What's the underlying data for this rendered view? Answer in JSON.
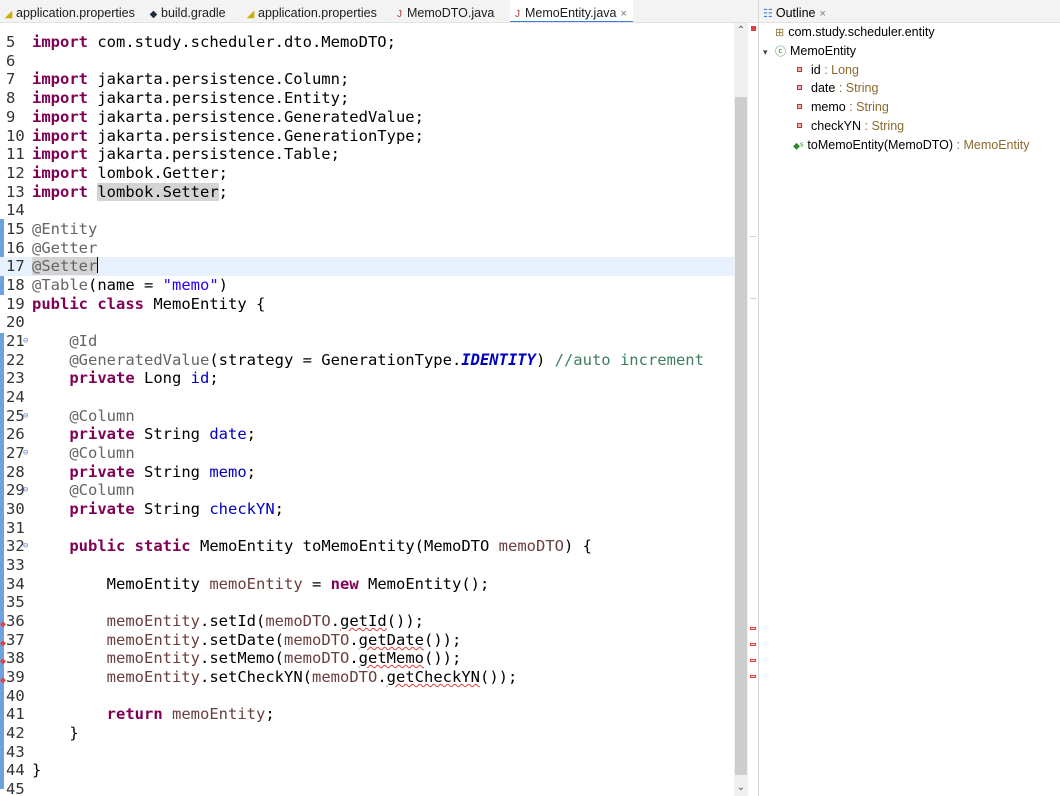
{
  "tabs": [
    {
      "label": "application.properties",
      "icon": "properties-file-icon",
      "active": false
    },
    {
      "label": "build.gradle",
      "icon": "gradle-file-icon",
      "active": false
    },
    {
      "label": "application.properties",
      "icon": "properties-file-icon",
      "active": false
    },
    {
      "label": "MemoDTO.java",
      "icon": "java-file-icon",
      "active": false
    },
    {
      "label": "MemoEntity.java",
      "icon": "java-file-icon",
      "active": true,
      "close": "×"
    }
  ],
  "editor": {
    "lines": {
      "l5": {
        "num": "5",
        "import_path": "com.study.scheduler.dto.MemoDTO"
      },
      "l6": {
        "num": "6"
      },
      "l7": {
        "num": "7",
        "import_path": "jakarta.persistence.Column"
      },
      "l8": {
        "num": "8",
        "import_path": "jakarta.persistence.Entity"
      },
      "l9": {
        "num": "9",
        "import_path": "jakarta.persistence.GeneratedValue"
      },
      "l10": {
        "num": "10",
        "import_path": "jakarta.persistence.GenerationType"
      },
      "l11": {
        "num": "11",
        "import_path": "jakarta.persistence.Table"
      },
      "l12": {
        "num": "12",
        "import_path": "lombok.Getter"
      },
      "l13": {
        "num": "13",
        "import_path": "lombok.Setter"
      },
      "l14": {
        "num": "14"
      },
      "l15": {
        "num": "15",
        "annotation": "@Entity"
      },
      "l16": {
        "num": "16",
        "annotation": "@Getter"
      },
      "l17": {
        "num": "17",
        "annotation": "@Setter"
      },
      "l18": {
        "num": "18",
        "annotation": "@Table",
        "args_pre": "(name = ",
        "string": "\"memo\"",
        "args_post": ")"
      },
      "l19": {
        "num": "19",
        "class_name": "MemoEntity"
      },
      "l20": {
        "num": "20"
      },
      "l21": {
        "num": "21",
        "annotation": "@Id"
      },
      "l22": {
        "num": "22",
        "annotation": "@GeneratedValue",
        "args_pre": "(strategy = GenerationType.",
        "constant": "IDENTITY",
        "args_post": ")",
        "comment": "//auto increment"
      },
      "l23": {
        "num": "23",
        "type": "Long",
        "field": "id"
      },
      "l24": {
        "num": "24"
      },
      "l25": {
        "num": "25",
        "annotation": "@Column"
      },
      "l26": {
        "num": "26",
        "type": "String",
        "field": "date"
      },
      "l27": {
        "num": "27",
        "annotation": "@Column"
      },
      "l28": {
        "num": "28",
        "type": "String",
        "field": "memo"
      },
      "l29": {
        "num": "29",
        "annotation": "@Column"
      },
      "l30": {
        "num": "30",
        "type": "String",
        "field": "checkYN"
      },
      "l31": {
        "num": "31"
      },
      "l32": {
        "num": "32",
        "return_type": "MemoEntity",
        "method": "toMemoEntity",
        "param_type": "MemoDTO",
        "param": "memoDTO"
      },
      "l33": {
        "num": "33"
      },
      "l34": {
        "num": "34",
        "type": "MemoEntity",
        "var": "memoEntity",
        "ctor": "MemoEntity"
      },
      "l35": {
        "num": "35"
      },
      "l36": {
        "num": "36",
        "target": "memoEntity",
        "setter": "setId",
        "src": "memoDTO",
        "getter": "getId"
      },
      "l37": {
        "num": "37",
        "target": "memoEntity",
        "setter": "setDate",
        "src": "memoDTO",
        "getter": "getDate"
      },
      "l38": {
        "num": "38",
        "target": "memoEntity",
        "setter": "setMemo",
        "src": "memoDTO",
        "getter": "getMemo"
      },
      "l39": {
        "num": "39",
        "target": "memoEntity",
        "setter": "setCheckYN",
        "src": "memoDTO",
        "getter": "getCheckYN"
      },
      "l40": {
        "num": "40"
      },
      "l41": {
        "num": "41",
        "var": "memoEntity"
      },
      "l42": {
        "num": "42"
      },
      "l43": {
        "num": "43"
      },
      "l44": {
        "num": "44"
      },
      "l45": {
        "num": "45"
      }
    }
  },
  "outline": {
    "title": "Outline",
    "close": "×",
    "package": "com.study.scheduler.entity",
    "class_name": "MemoEntity",
    "fields": [
      {
        "name": "id",
        "type": " : Long"
      },
      {
        "name": "date",
        "type": " : String"
      },
      {
        "name": "memo",
        "type": " : String"
      },
      {
        "name": "checkYN",
        "type": " : String"
      }
    ],
    "method": {
      "name": "toMemoEntity(MemoDTO)",
      "type": " : MemoEntity"
    }
  },
  "colors": {
    "keyword": "#7f0055",
    "annotation": "#646464",
    "string": "#2a00ff",
    "field": "#0000c0",
    "comment": "#3f7f5f",
    "local_var": "#6a3e3e",
    "current_line": "#e8f2fe",
    "active_tab_accent": "#3f7dd6",
    "error": "#e04040"
  }
}
